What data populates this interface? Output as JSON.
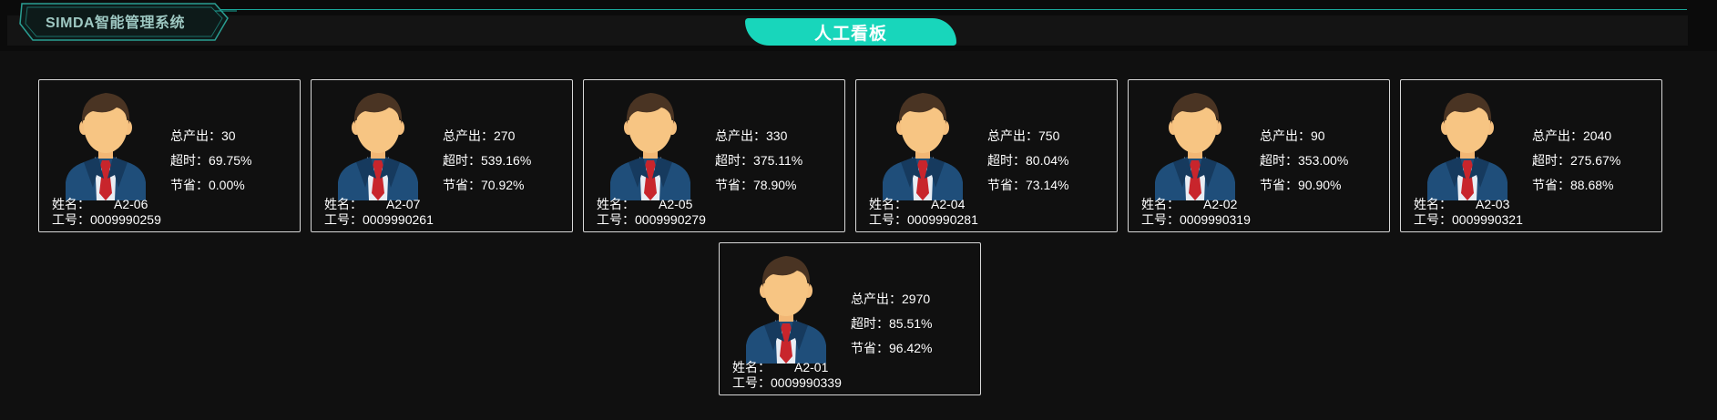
{
  "app": {
    "logo_text": "SIMDA智能管理系统",
    "board_title": "人工看板"
  },
  "labels": {
    "output": "总产出：",
    "overtime": "超时：",
    "saving": "节省：",
    "name": "姓名：",
    "job_no": "工号："
  },
  "colors": {
    "accent": "#18d6bb",
    "background": "#101010",
    "card_border": "#d8d8d8"
  },
  "workers": [
    {
      "name": "A2-06",
      "job_no": "0009990259",
      "output": "30",
      "overtime": "69.75%",
      "saving": "0.00%",
      "avatar": "male-worker-avatar-icon"
    },
    {
      "name": "A2-07",
      "job_no": "0009990261",
      "output": "270",
      "overtime": "539.16%",
      "saving": "70.92%",
      "avatar": "male-worker-avatar-icon"
    },
    {
      "name": "A2-05",
      "job_no": "0009990279",
      "output": "330",
      "overtime": "375.11%",
      "saving": "78.90%",
      "avatar": "male-worker-avatar-icon"
    },
    {
      "name": "A2-04",
      "job_no": "0009990281",
      "output": "750",
      "overtime": "80.04%",
      "saving": "73.14%",
      "avatar": "male-worker-avatar-icon"
    },
    {
      "name": "A2-02",
      "job_no": "0009990319",
      "output": "90",
      "overtime": "353.00%",
      "saving": "90.90%",
      "avatar": "male-worker-avatar-icon"
    },
    {
      "name": "A2-03",
      "job_no": "0009990321",
      "output": "2040",
      "overtime": "275.67%",
      "saving": "88.68%",
      "avatar": "male-worker-avatar-icon"
    },
    {
      "name": "A2-01",
      "job_no": "0009990339",
      "output": "2970",
      "overtime": "85.51%",
      "saving": "96.42%",
      "avatar": "male-worker-avatar-icon"
    }
  ]
}
